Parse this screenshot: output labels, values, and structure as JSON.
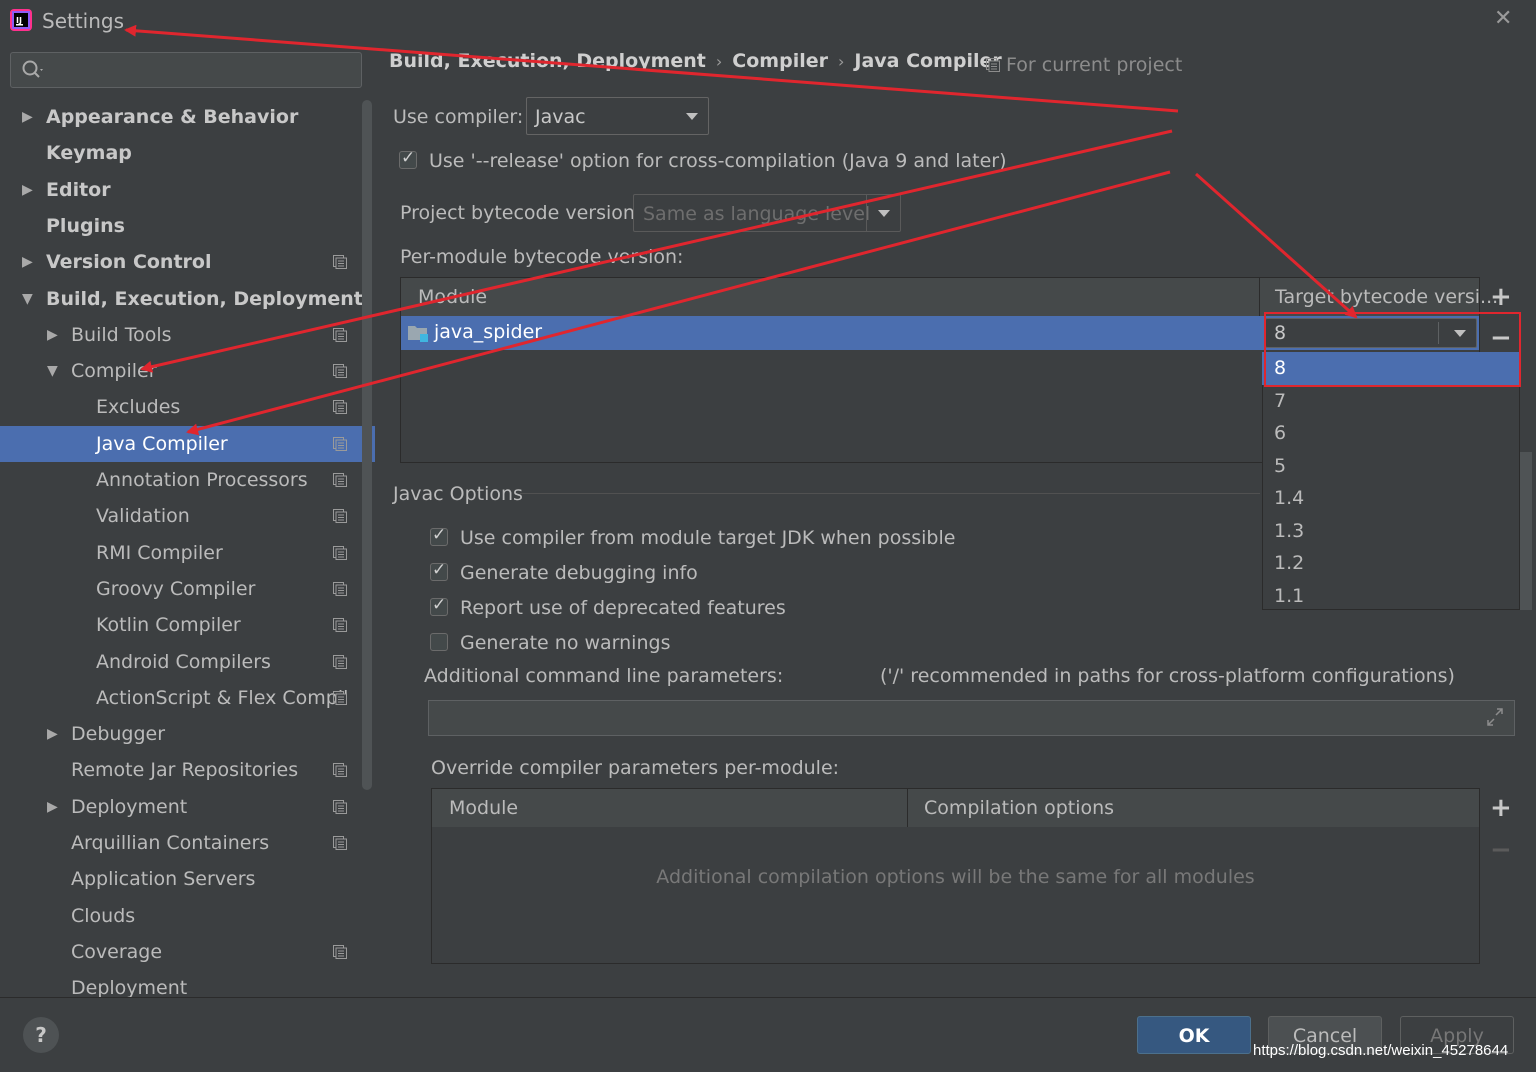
{
  "window": {
    "title": "Settings",
    "close_glyph": "✕"
  },
  "search": {
    "value": ""
  },
  "sidebar": {
    "items": [
      {
        "label": "Appearance & Behavior",
        "bold": true,
        "arrow": "right",
        "project": false
      },
      {
        "label": "Keymap",
        "bold": true,
        "arrow": "",
        "project": false
      },
      {
        "label": "Editor",
        "bold": true,
        "arrow": "right",
        "project": false
      },
      {
        "label": "Plugins",
        "bold": true,
        "arrow": "",
        "project": false
      },
      {
        "label": "Version Control",
        "bold": true,
        "arrow": "right",
        "project": true
      },
      {
        "label": "Build, Execution, Deployment",
        "bold": true,
        "arrow": "down",
        "project": false
      },
      {
        "label": "Build Tools",
        "bold": false,
        "arrow": "right",
        "project": true
      },
      {
        "label": "Compiler",
        "bold": false,
        "arrow": "down",
        "project": true
      },
      {
        "label": "Excludes",
        "bold": false,
        "arrow": "",
        "project": true
      },
      {
        "label": "Java Compiler",
        "bold": false,
        "arrow": "",
        "project": true,
        "selected": true
      },
      {
        "label": "Annotation Processors",
        "bold": false,
        "arrow": "",
        "project": true
      },
      {
        "label": "Validation",
        "bold": false,
        "arrow": "",
        "project": true
      },
      {
        "label": "RMI Compiler",
        "bold": false,
        "arrow": "",
        "project": true
      },
      {
        "label": "Groovy Compiler",
        "bold": false,
        "arrow": "",
        "project": true
      },
      {
        "label": "Kotlin Compiler",
        "bold": false,
        "arrow": "",
        "project": true
      },
      {
        "label": "Android Compilers",
        "bold": false,
        "arrow": "",
        "project": true
      },
      {
        "label": "ActionScript & Flex Compil",
        "bold": false,
        "arrow": "",
        "project": true
      },
      {
        "label": "Debugger",
        "bold": false,
        "arrow": "right",
        "project": false
      },
      {
        "label": "Remote Jar Repositories",
        "bold": false,
        "arrow": "",
        "project": true
      },
      {
        "label": "Deployment",
        "bold": false,
        "arrow": "right",
        "project": true
      },
      {
        "label": "Arquillian Containers",
        "bold": false,
        "arrow": "",
        "project": true
      },
      {
        "label": "Application Servers",
        "bold": false,
        "arrow": "",
        "project": false
      },
      {
        "label": "Clouds",
        "bold": false,
        "arrow": "",
        "project": false
      },
      {
        "label": "Coverage",
        "bold": false,
        "arrow": "",
        "project": true
      },
      {
        "label": "Deployment",
        "bold": false,
        "arrow": "",
        "project": false
      }
    ]
  },
  "breadcrumb": {
    "parts": [
      "Build, Execution, Deployment",
      "Compiler",
      "Java Compiler"
    ],
    "separator": "›",
    "scope": "For current project"
  },
  "compiler": {
    "use_compiler_label": "Use compiler:",
    "use_compiler_value": "Javac",
    "release_option_label": "Use '--release' option for cross-compilation (Java 9 and later)",
    "release_option_checked": true,
    "project_bytecode_label": "Project bytecode version:",
    "project_bytecode_placeholder": "Same as language level",
    "per_module_label": "Per-module bytecode version:"
  },
  "module_table": {
    "columns": [
      "Module",
      "Target bytecode versi..."
    ],
    "rows": [
      {
        "module": "java_spider",
        "target": "8"
      }
    ],
    "plus": "+",
    "minus": "−"
  },
  "dropdown": {
    "options": [
      "8",
      "7",
      "6",
      "5",
      "1.4",
      "1.3",
      "1.2",
      "1.1"
    ],
    "selected": "8"
  },
  "javac_options": {
    "section_title": "Javac Options",
    "checkboxes": [
      {
        "label": "Use compiler from module target JDK when possible",
        "checked": true
      },
      {
        "label": "Generate debugging info",
        "checked": true
      },
      {
        "label": "Report use of deprecated features",
        "checked": true
      },
      {
        "label": "Generate no warnings",
        "checked": false
      }
    ],
    "additional_params_label": "Additional command line parameters:",
    "additional_params_hint": "('/' recommended in paths for cross-platform configurations)",
    "additional_params_value": "",
    "override_label": "Override compiler parameters per-module:",
    "override_columns": [
      "Module",
      "Compilation options"
    ],
    "override_empty": "Additional compilation options will be the same for all modules"
  },
  "footer": {
    "help": "?",
    "ok": "OK",
    "cancel": "Cancel",
    "apply": "Apply",
    "watermark": "https://blog.csdn.net/weixin_45278644"
  },
  "colors": {
    "background": "#3c3f41",
    "selection": "#4b6eaf",
    "annotation_red": "#e0262e",
    "ok_button": "#365880"
  }
}
